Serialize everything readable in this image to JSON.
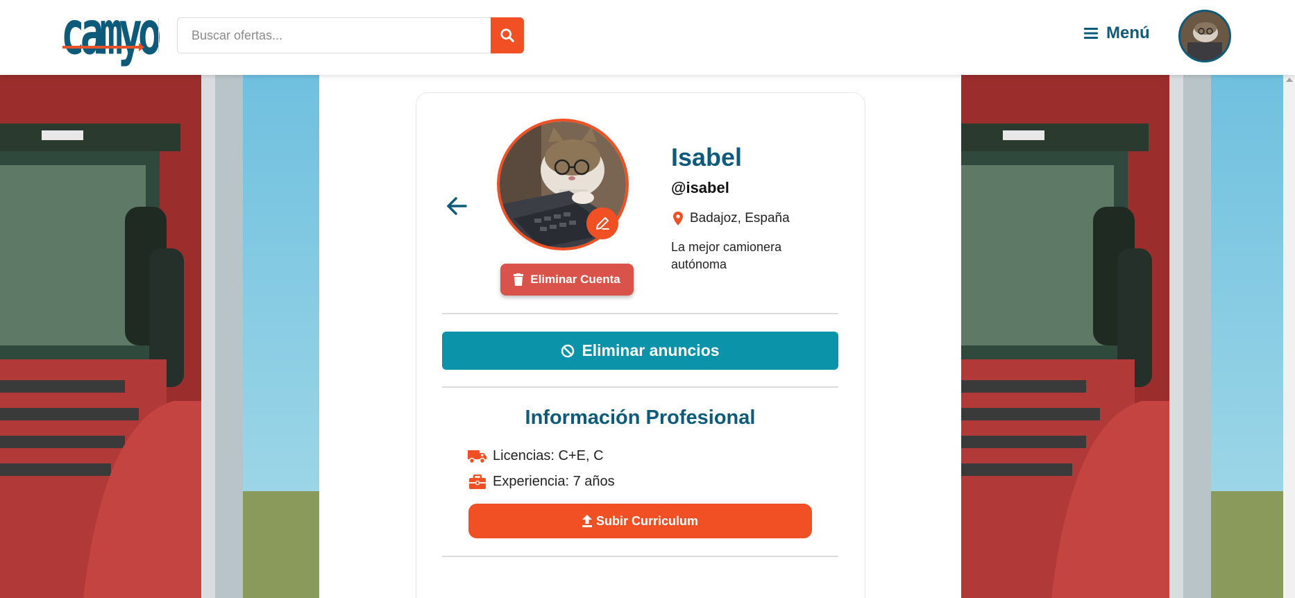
{
  "header": {
    "logo_text": "camyo",
    "search": {
      "placeholder": "Buscar ofertas...",
      "value": ""
    },
    "menu_label": "Menú"
  },
  "profile": {
    "name": "Isabel",
    "handle": "@isabel",
    "location": "Badajoz, España",
    "bio": "La mejor camionera autónoma",
    "delete_account_label": "Eliminar Cuenta"
  },
  "actions": {
    "remove_ads_label": "Eliminar anuncios"
  },
  "professional_info": {
    "title": "Información Profesional",
    "licenses": "Licencias: C+E, C",
    "experience": "Experiencia: 7 años",
    "upload_cv_label": "Subir Curriculum"
  },
  "colors": {
    "brand_blue": "#0d5a7a",
    "accent_orange": "#f05023",
    "danger_red": "#d9534a",
    "teal": "#0b93aa"
  },
  "icons": [
    "search-icon",
    "menu-icon",
    "arrow-left-icon",
    "pencil-icon",
    "trash-icon",
    "map-pin-icon",
    "ban-icon",
    "truck-icon",
    "briefcase-icon",
    "upload-icon"
  ]
}
